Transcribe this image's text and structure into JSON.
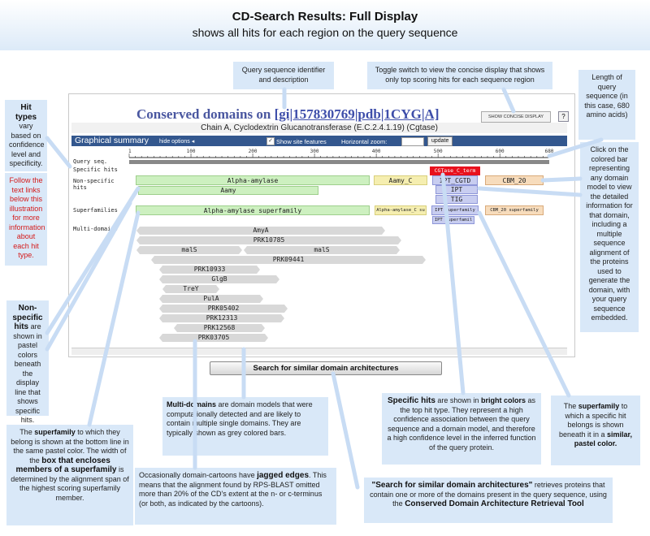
{
  "banner": {
    "title": "CD-Search Results:  Full Display",
    "subtitle": "shows all hits for each region on the query sequence"
  },
  "callouts": {
    "query_id": "Query sequence identifier and description",
    "toggle": "Toggle switch to view the concise display that shows only top scoring hits for each sequence region",
    "length": "Length of query sequence (in this case, 680 amino acids)",
    "hit_types_bold": "Hit types",
    "hit_types_rest": "vary based on confidence level and specificity.",
    "follow_links": "Follow the text links below this illustration for more information about each hit type.",
    "click_bar": "Click on the colored bar representing any domain model to view the detailed information for that domain, including a multiple sequence alignment of the proteins used to generate the domain, with your query sequence embedded.",
    "nonspecific_bold": "Non-specific hits",
    "nonspecific_rest": "are shown in pastel colors beneath the display line that shows specific hits.",
    "superfamily_pre": "The",
    "superfamily_bold": "superfamily",
    "superfamily_mid": "to which they belong is shown at the bottom line in the same pastel color.  The width of the",
    "superfamily_box": "box that encloses members of a superfamily",
    "superfamily_end": "is determined by the alignment span of the highest scoring superfamily member.",
    "multidomain_bold": "Multi-domains",
    "multidomain_rest": "are domain models that were computationally detected and are likely to contain multiple single domains.  They are typically shown as grey colored bars.",
    "jagged_pre": "Occasionally domain-cartoons have",
    "jagged_bold": "jagged edges",
    "jagged_rest": ". This means that the alignment found by RPS-BLAST omitted more than 20% of the CD's extent at the n- or c-terminus (or both, as indicated by the cartoons).",
    "specific_bold": "Specific hits",
    "specific_mid": "are shown in",
    "specific_bright": "bright colors",
    "specific_rest": "as the top hit type.  They represent a high confidence association between the query sequence and a domain model, and therefore a high confidence level in the inferred function of the query protein.",
    "sfam_pre": "The",
    "sfam_bold": "superfamily",
    "sfam_mid": "to which a specific hit belongs is shown beneath it in a",
    "sfam_color": "similar, pastel color.",
    "search_bold": "\"Search for similar domain architectures\"",
    "search_rest": "retrieves proteins that contain one or more of the domains present in the query sequence, using the",
    "search_tool": "Conserved Domain Architecture Retrieval Tool"
  },
  "panel": {
    "title_prefix": "Conserved domains on",
    "title_link": "[gi|157830769|pdb|1CYG|A]",
    "concise_button": "SHOW CONCISE DISPLAY",
    "help": "?",
    "description": "Chain A, Cyclodextrin Glucanotransferase (E.C.2.4.1.19) (Cgtase)",
    "graphical_summary": "Graphical summary",
    "hide_options": "hide options ◂",
    "show_site_features": "Show site features",
    "horizontal_zoom": "Horizontal zoom:",
    "update": "update",
    "ruler_ticks": [
      "1",
      "100",
      "200",
      "300",
      "400",
      "500",
      "600",
      "680"
    ],
    "row_labels": {
      "query_seq": "Query seq.",
      "specific_hits": "Specific hits",
      "nonspecific_hits": "Non-specific hits",
      "superfamilies": "Superfamilies",
      "multidomains": "Multi-domains"
    },
    "specific": [
      "CGTase_C_term"
    ],
    "nonspecific": [
      "Alpha-amylase",
      "Aamy",
      "Aamy_C",
      "IPT_CGTD",
      "IPT",
      "TIG",
      "CBM_20"
    ],
    "superfamilies": [
      "Alpha-amylase superfamily",
      "Alpha-amylase_C su",
      "IPT superfamily",
      "IPT superfamil",
      "CBM_20 superfamily"
    ],
    "multidomains": [
      "AmyA",
      "PRK10785",
      "malS",
      "malS",
      "PRK09441",
      "PRK10933",
      "GlgB",
      "TreY",
      "PulA",
      "PRK05402",
      "PRK12313",
      "PRK12568",
      "PRK03705"
    ],
    "search_button": "Search for similar domain architectures"
  },
  "colors": {
    "banner": "#dceaf8",
    "callout": "#d9e8f8",
    "gs_bar": "#33578e",
    "specific": "#e8101c",
    "nonspecific_green": "#cdf0c0",
    "nonspecific_yellow": "#f5eeb0",
    "nonspecific_blue": "#c8cdf0",
    "nonspecific_orange": "#f7dcbc",
    "multidomain_grey": "#d8d8d8"
  }
}
